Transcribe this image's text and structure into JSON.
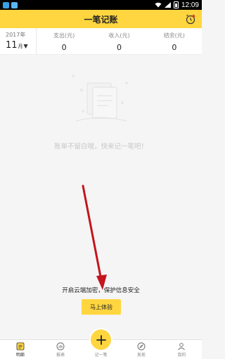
{
  "status_bar": {
    "time": "12:09"
  },
  "header": {
    "title": "一笔记账",
    "accent": "#ffd63f"
  },
  "summary": {
    "year": "2017年",
    "month": "11",
    "month_unit": "月",
    "stats": [
      {
        "label": "支出(元)",
        "value": "0"
      },
      {
        "label": "收入(元)",
        "value": "0"
      },
      {
        "label": "结余(元)",
        "value": "0"
      }
    ]
  },
  "empty_state": {
    "message": "账单不留白哦，快来记一笔吧！"
  },
  "cloud_promo": {
    "text": "开启云端加密，保护信息安全",
    "button_label": "马上体验"
  },
  "bottom_nav": {
    "items": [
      {
        "label": "明细",
        "icon": "ledger-icon"
      },
      {
        "label": "报表",
        "icon": "chart-icon"
      },
      {
        "label": "记一笔",
        "icon": "plus-icon"
      },
      {
        "label": "发现",
        "icon": "compass-icon"
      },
      {
        "label": "我的",
        "icon": "user-icon"
      }
    ]
  }
}
